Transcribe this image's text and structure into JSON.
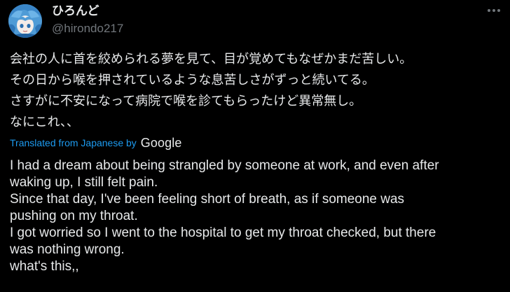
{
  "user": {
    "display_name": "ひろんど",
    "handle": "@hirondo217",
    "avatar_icon": "avatar-illustration-icon"
  },
  "menu": {
    "more_icon": "more-horizontal-icon"
  },
  "tweet": {
    "original_lines": [
      "会社の人に首を絞められる夢を見て、目が覚めてもなぜかまだ苦しい。",
      "その日から喉を押されているような息苦しさがずっと続いてる。",
      "さすがに不安になって病院で喉を診てもらったけど異常無し。",
      "なにこれ、、"
    ],
    "translation_label": "Translated from Japanese by",
    "translation_provider": "Google",
    "translated_lines": [
      "I had a dream about being strangled by someone at work, and even after",
      "waking up, I still felt pain.",
      "Since that day, I've been feeling short of breath, as if someone was",
      "pushing on my throat.",
      "I got worried so I went to the hospital to get my throat checked, but there",
      "was nothing wrong.",
      "what's this,,"
    ]
  },
  "colors": {
    "background": "#000000",
    "text": "#e7e9ea",
    "muted": "#71767b",
    "link": "#1d9bf0"
  }
}
